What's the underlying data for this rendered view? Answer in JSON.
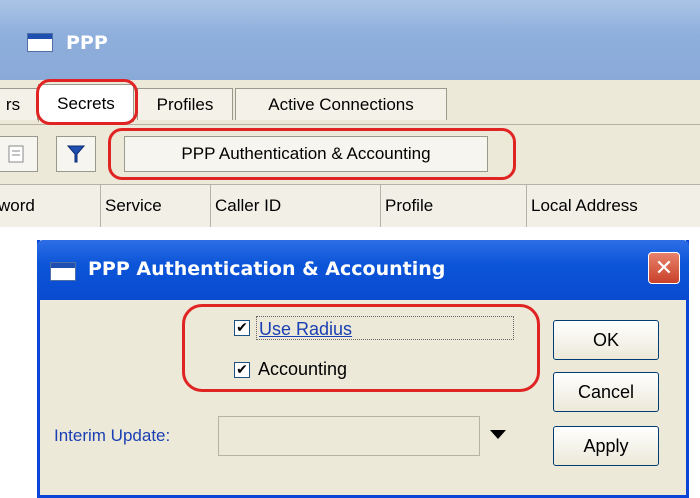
{
  "ppp_window": {
    "title": "PPP",
    "tabs": [
      {
        "label": "rs"
      },
      {
        "label": "Secrets"
      },
      {
        "label": "Profiles"
      },
      {
        "label": "Active Connections"
      }
    ],
    "toolbar": {
      "aaa_button_label": "PPP Authentication & Accounting"
    },
    "columns": [
      "word",
      "Service",
      "Caller ID",
      "Profile",
      "Local Address"
    ]
  },
  "dialog": {
    "title": "PPP Authentication & Accounting",
    "close_glyph": "✕",
    "use_radius": {
      "label": "Use Radius",
      "checked": true
    },
    "accounting": {
      "label": "Accounting",
      "checked": true
    },
    "interim_update": {
      "label": "Interim Update:",
      "value": ""
    },
    "buttons": {
      "ok": "OK",
      "cancel": "Cancel",
      "apply": "Apply"
    }
  },
  "icons": {
    "window": "window-icon",
    "filter": "filter-icon",
    "dropdown": "dropdown-arrow-icon",
    "close": "close-icon"
  },
  "colors": {
    "highlight_ring": "#e02424",
    "dialog_titlebar": "#0b55d8",
    "link_text": "#1a3fb4"
  }
}
